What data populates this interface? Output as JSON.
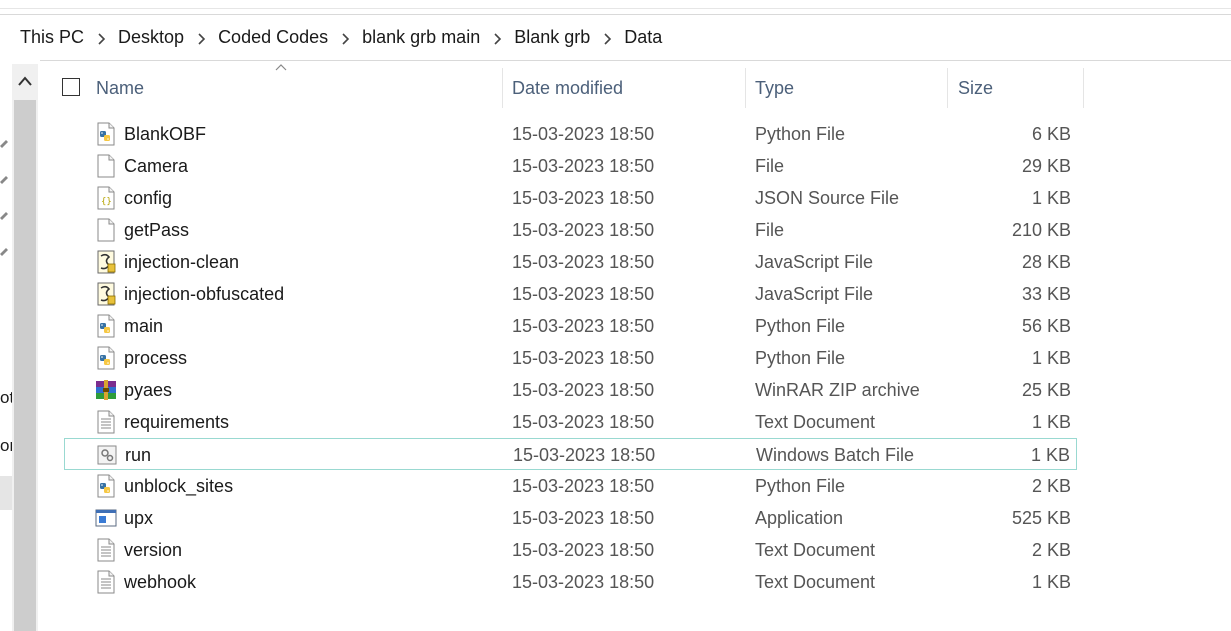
{
  "breadcrumb": [
    "This PC",
    "Desktop",
    "Coded Codes",
    "blank grb main",
    "Blank grb",
    "Data"
  ],
  "nav": {
    "partial_labels": [
      "oti",
      "on"
    ]
  },
  "columns": {
    "name": "Name",
    "date": "Date modified",
    "type": "Type",
    "size": "Size"
  },
  "files": [
    {
      "name": "BlankOBF",
      "date": "15-03-2023 18:50",
      "type": "Python File",
      "size": "6 KB",
      "icon": "python-file-icon"
    },
    {
      "name": "Camera",
      "date": "15-03-2023 18:50",
      "type": "File",
      "size": "29 KB",
      "icon": "blank-file-icon"
    },
    {
      "name": "config",
      "date": "15-03-2023 18:50",
      "type": "JSON Source File",
      "size": "1 KB",
      "icon": "json-file-icon"
    },
    {
      "name": "getPass",
      "date": "15-03-2023 18:50",
      "type": "File",
      "size": "210 KB",
      "icon": "blank-file-icon"
    },
    {
      "name": "injection-clean",
      "date": "15-03-2023 18:50",
      "type": "JavaScript File",
      "size": "28 KB",
      "icon": "javascript-file-icon"
    },
    {
      "name": "injection-obfuscated",
      "date": "15-03-2023 18:50",
      "type": "JavaScript File",
      "size": "33 KB",
      "icon": "javascript-file-icon"
    },
    {
      "name": "main",
      "date": "15-03-2023 18:50",
      "type": "Python File",
      "size": "56 KB",
      "icon": "python-file-icon"
    },
    {
      "name": "process",
      "date": "15-03-2023 18:50",
      "type": "Python File",
      "size": "1 KB",
      "icon": "python-file-icon"
    },
    {
      "name": "pyaes",
      "date": "15-03-2023 18:50",
      "type": "WinRAR ZIP archive",
      "size": "25 KB",
      "icon": "winrar-archive-icon"
    },
    {
      "name": "requirements",
      "date": "15-03-2023 18:50",
      "type": "Text Document",
      "size": "1 KB",
      "icon": "text-file-icon"
    },
    {
      "name": "run",
      "date": "15-03-2023 18:50",
      "type": "Windows Batch File",
      "size": "1 KB",
      "icon": "batch-file-icon"
    },
    {
      "name": "unblock_sites",
      "date": "15-03-2023 18:50",
      "type": "Python File",
      "size": "2 KB",
      "icon": "python-file-icon"
    },
    {
      "name": "upx",
      "date": "15-03-2023 18:50",
      "type": "Application",
      "size": "525 KB",
      "icon": "application-icon"
    },
    {
      "name": "version",
      "date": "15-03-2023 18:50",
      "type": "Text Document",
      "size": "2 KB",
      "icon": "text-file-icon"
    },
    {
      "name": "webhook",
      "date": "15-03-2023 18:50",
      "type": "Text Document",
      "size": "1 KB",
      "icon": "text-file-icon"
    }
  ],
  "selected_file": "run",
  "colors": {
    "header_text": "#4c607a",
    "selection_border": "#99d9d1",
    "secondary_text": "#555555"
  }
}
